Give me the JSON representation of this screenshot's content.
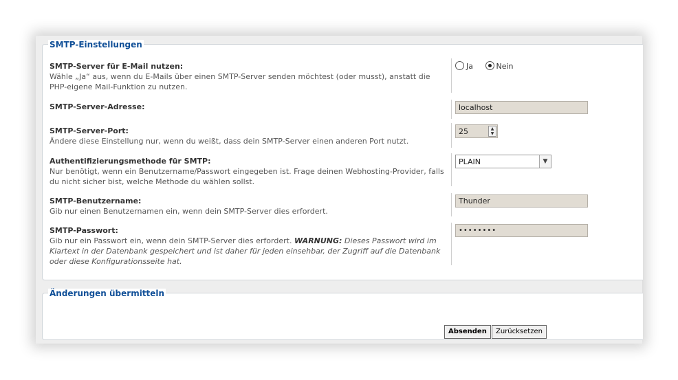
{
  "smtp_section": {
    "legend": "SMTP-Einstellungen",
    "use_smtp": {
      "title": "SMTP-Server für E-Mail nutzen:",
      "desc": "Wähle „Ja“ aus, wenn du E-Mails über einen SMTP-Server senden möchtest (oder musst), anstatt die PHP-eigene Mail-Funktion zu nutzen.",
      "option_yes": "Ja",
      "option_no": "Nein",
      "selected": "Nein"
    },
    "address": {
      "title": "SMTP-Server-Adresse:",
      "value": "localhost"
    },
    "port": {
      "title": "SMTP-Server-Port:",
      "desc": "Ändere diese Einstellung nur, wenn du weißt, dass dein SMTP-Server einen anderen Port nutzt.",
      "value": "25"
    },
    "auth": {
      "title": "Authentifizierungsmethode für SMTP:",
      "desc": "Nur benötigt, wenn ein Benutzername/Passwort eingegeben ist. Frage deinen Webhosting-Provider, falls du nicht sicher bist, welche Methode du wählen sollst.",
      "value": "PLAIN"
    },
    "username": {
      "title": "SMTP-Benutzername:",
      "desc": "Gib nur einen Benutzernamen ein, wenn dein SMTP-Server dies erfordert.",
      "value": "Thunder"
    },
    "password": {
      "title": "SMTP-Passwort:",
      "desc_plain": "Gib nur ein Passwort ein, wenn dein SMTP-Server dies erfordert. ",
      "warning_label": "WARNUNG:",
      "warning_text": " Dieses Passwort wird im Klartext in der Datenbank gespeichert und ist daher für jeden einsehbar, der Zugriff auf die Datenbank oder diese Konfigurationsseite hat.",
      "value": "••••••••"
    }
  },
  "submit_section": {
    "legend": "Änderungen übermitteln",
    "submit_label": "Absenden",
    "reset_label": "Zurücksetzen"
  }
}
